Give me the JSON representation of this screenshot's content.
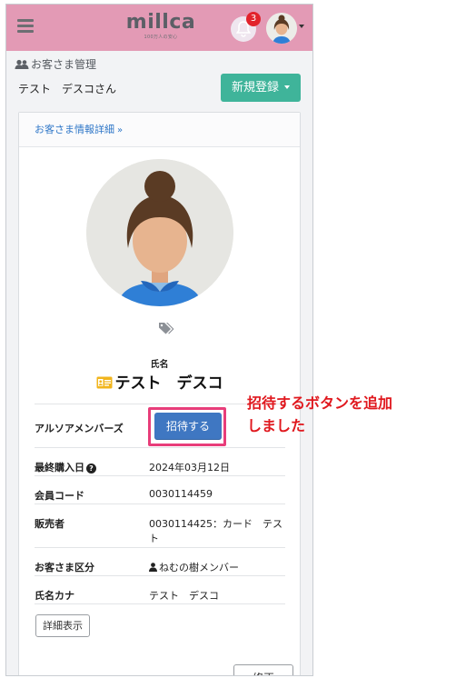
{
  "header": {
    "logo_text": "millca",
    "logo_sub": "100万人の安心",
    "notification_count": "3"
  },
  "page": {
    "section_title": "お客さま管理",
    "customer_name": "テスト　デスコさん",
    "new_button": "新規登録"
  },
  "card": {
    "tab_label": "お客さま情報詳細",
    "tab_chevron": "»",
    "name_label": "氏名",
    "name_value": "テスト　デスコ",
    "rows": [
      {
        "key": "アルソアメンバーズ",
        "button": "招待する"
      },
      {
        "key": "最終購入日",
        "value": "2024年03月12日"
      },
      {
        "key": "会員コード",
        "value": "0030114459"
      },
      {
        "key": "販売者",
        "value": "0030114425：カード　テスト"
      },
      {
        "key": "お客さま区分",
        "value": "ねむの樹メンバー"
      },
      {
        "key": "氏名カナ",
        "value": "テスト　デスコ"
      }
    ],
    "detail_button": "詳細表示",
    "edit_button": "修正"
  },
  "annotation": {
    "line1": "招待するボタンを追加",
    "line2": "しました"
  },
  "colors": {
    "header": "#e39ab5",
    "accent_green": "#3fb49a",
    "accent_blue": "#3f77c2",
    "highlight": "#e83d7a",
    "annotation": "#e0181e"
  }
}
